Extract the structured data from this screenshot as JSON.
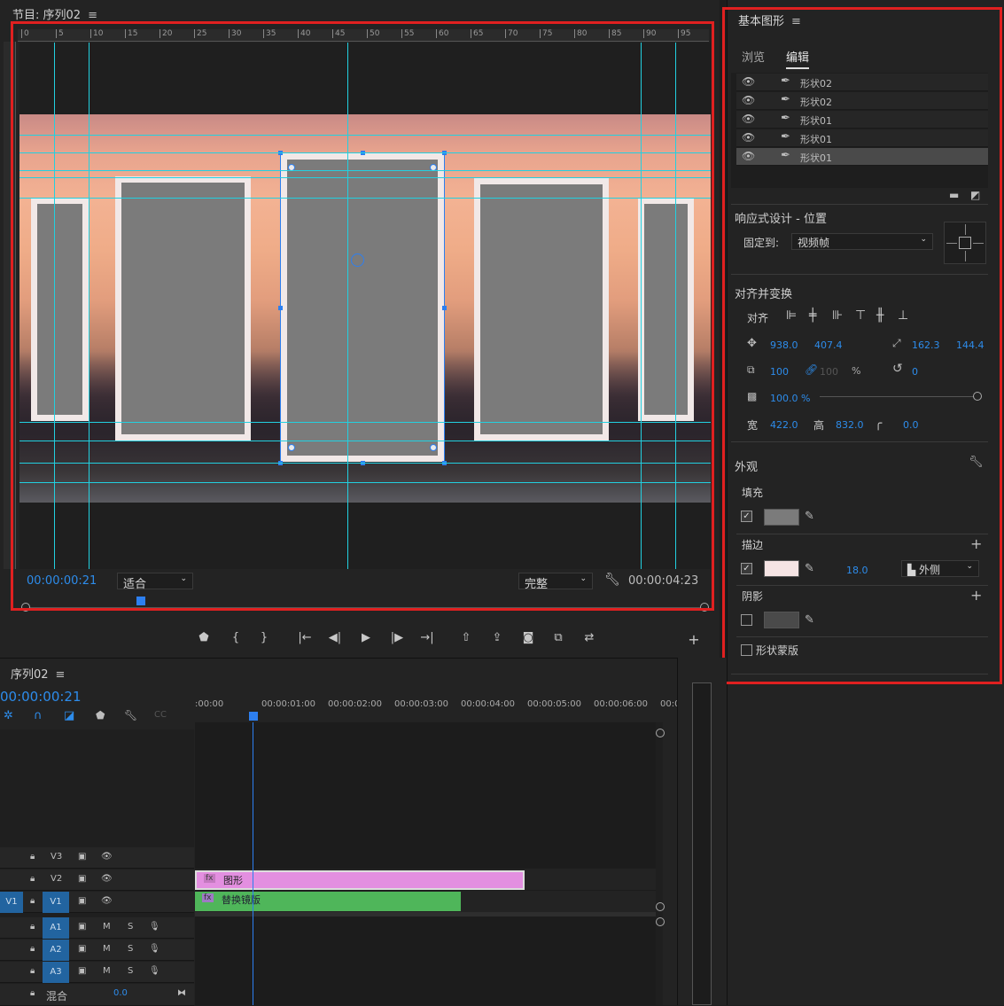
{
  "monitor": {
    "title": "节目: 序列02",
    "ruler_labels": [
      "0",
      "5",
      "10",
      "15",
      "20",
      "25",
      "30",
      "35",
      "40",
      "45",
      "50",
      "55",
      "60",
      "65",
      "70",
      "75",
      "80",
      "85",
      "90",
      "95"
    ],
    "timecode_current": "00:00:00:21",
    "fit_label": "适合",
    "quality_label": "完整",
    "timecode_duration": "00:00:04:23"
  },
  "essential": {
    "title": "基本图形",
    "tabs": [
      "浏览",
      "编辑"
    ],
    "layers": [
      "形状02",
      "形状02",
      "形状01",
      "形状01",
      "形状01"
    ],
    "responsive_title": "响应式设计 - 位置",
    "pin_label": "固定到:",
    "pin_value": "视频帧",
    "align_title": "对齐并变换",
    "align_label": "对齐",
    "pos_x": "938.0",
    "pos_y": "407.4",
    "anchor_x": "162.3",
    "anchor_y": "144.4",
    "scale": "100",
    "scale_locked": "100",
    "percent": "%",
    "rotation": "0",
    "opacity": "100.0 %",
    "width_label": "宽",
    "width": "422.0",
    "height_label": "高",
    "height": "832.0",
    "corner": "0.0",
    "appearance_title": "外观",
    "fill_label": "填充",
    "stroke_label": "描边",
    "stroke_width": "18.0",
    "stroke_type": "外侧",
    "shadow_label": "阴影",
    "mask_label": "形状蒙版",
    "colors": {
      "fill": "#7b7b7b",
      "stroke": "#f5e4e4",
      "shadow": "#4a4a4a"
    }
  },
  "timeline": {
    "title": "序列02",
    "timecode": "00:00:00:21",
    "ticks": [
      ":00:00",
      "00:00:01:00",
      "00:00:02:00",
      "00:00:03:00",
      "00:00:04:00",
      "00:00:05:00",
      "00:00:06:00",
      "00:0"
    ],
    "tracks_video": [
      {
        "name": "V3",
        "tag": ""
      },
      {
        "name": "V2",
        "tag": ""
      },
      {
        "name": "V1",
        "tag": "V1"
      }
    ],
    "tracks_audio": [
      {
        "name": "A1",
        "m": "M",
        "s": "S"
      },
      {
        "name": "A2",
        "m": "M",
        "s": "S"
      },
      {
        "name": "A3",
        "m": "M",
        "s": "S"
      }
    ],
    "mix_label": "混合",
    "mix_value": "0.0",
    "clip_v2": "图形",
    "clip_v1": "替换镜版",
    "fx": "fx"
  }
}
